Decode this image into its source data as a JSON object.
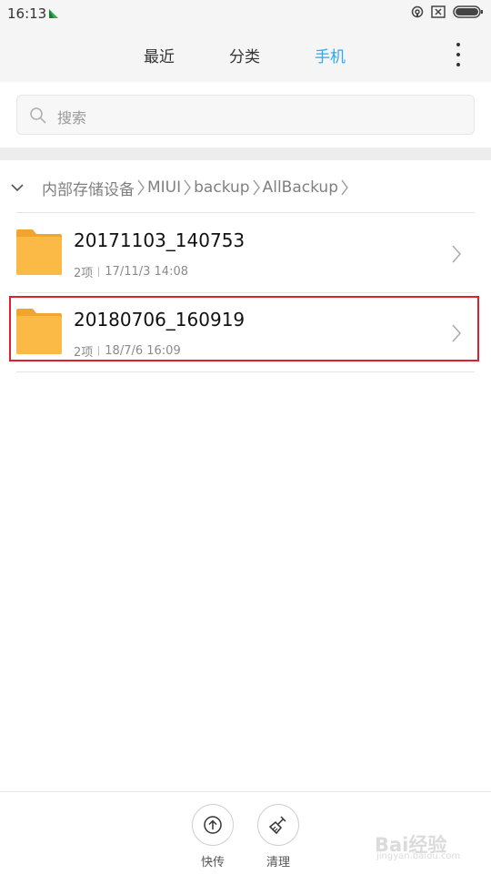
{
  "status_bar": {
    "time": "16:13"
  },
  "tabs": [
    {
      "label": "最近",
      "active": false
    },
    {
      "label": "分类",
      "active": false
    },
    {
      "label": "手机",
      "active": true
    }
  ],
  "search": {
    "placeholder": "搜索"
  },
  "breadcrumb": [
    "内部存储设备",
    "MIUI",
    "backup",
    "AllBackup"
  ],
  "files": [
    {
      "name": "20171103_140753",
      "items": "2项",
      "date": "17/11/3 14:08",
      "highlighted": false
    },
    {
      "name": "20180706_160919",
      "items": "2项",
      "date": "18/7/6 16:09",
      "highlighted": true
    }
  ],
  "bottom": {
    "quick_send": "快传",
    "clean": "清理"
  },
  "watermark": {
    "text": "Bai经验",
    "url": "jingyan.baidu.com"
  },
  "colors": {
    "accent": "#2da8f3",
    "folder": "#fbb946",
    "highlight": "#e0202e"
  }
}
